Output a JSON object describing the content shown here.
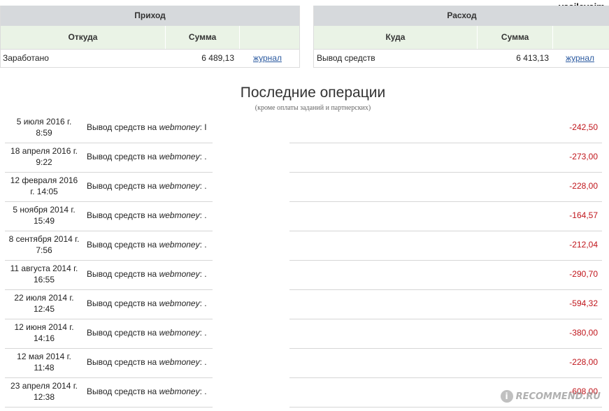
{
  "username": "vasilevaim",
  "income": {
    "title": "Приход",
    "col_source": "Откуда",
    "col_sum": "Сумма",
    "row_label": "Заработано",
    "row_sum": "6 489,13",
    "link": "журнал"
  },
  "expense": {
    "title": "Расход",
    "col_dest": "Куда",
    "col_sum": "Сумма",
    "row_label": "Вывод средств",
    "row_sum": "6 413,13",
    "link": "журнал"
  },
  "operations": {
    "title": "Последние операции",
    "subtitle": "(кроме оплаты заданий и партнерских)",
    "desc_prefix": "Вывод средств на",
    "desc_service": "webmoney",
    "items": [
      {
        "date_line1": "5 июля 2016 г.",
        "date_line2": "8:59",
        "suffix": ": I",
        "amount": "-242,50"
      },
      {
        "date_line1": "18 апреля 2016 г.",
        "date_line2": "9:22",
        "suffix": ": .",
        "amount": "-273,00"
      },
      {
        "date_line1": "12 февраля 2016",
        "date_line2": "г. 14:05",
        "suffix": ": .",
        "amount": "-228,00"
      },
      {
        "date_line1": "5 ноября 2014 г.",
        "date_line2": "15:49",
        "suffix": ": .",
        "amount": "-164,57"
      },
      {
        "date_line1": "8 сентября 2014 г.",
        "date_line2": "7:56",
        "suffix": ": .",
        "amount": "-212,04"
      },
      {
        "date_line1": "11 августа 2014 г.",
        "date_line2": "16:55",
        "suffix": ": .",
        "amount": "-290,70"
      },
      {
        "date_line1": "22 июля 2014 г.",
        "date_line2": "12:45",
        "suffix": ": .",
        "amount": "-594,32"
      },
      {
        "date_line1": "12 июня 2014 г.",
        "date_line2": "14:16",
        "suffix": ": .",
        "amount": "-380,00"
      },
      {
        "date_line1": "12 мая 2014 г.",
        "date_line2": "11:48",
        "suffix": ": .",
        "amount": "-228,00"
      },
      {
        "date_line1": "23 апреля 2014 г.",
        "date_line2": "12:38",
        "suffix": ": .",
        "amount": "-608,00"
      }
    ]
  },
  "watermark": {
    "badge": "i",
    "text": "RECOMMEND.RU"
  },
  "colors": {
    "negative": "#c0151b",
    "header_bg": "#d6d9dc",
    "subheader_bg": "#eaf3e6",
    "link": "#2b5aa0"
  }
}
